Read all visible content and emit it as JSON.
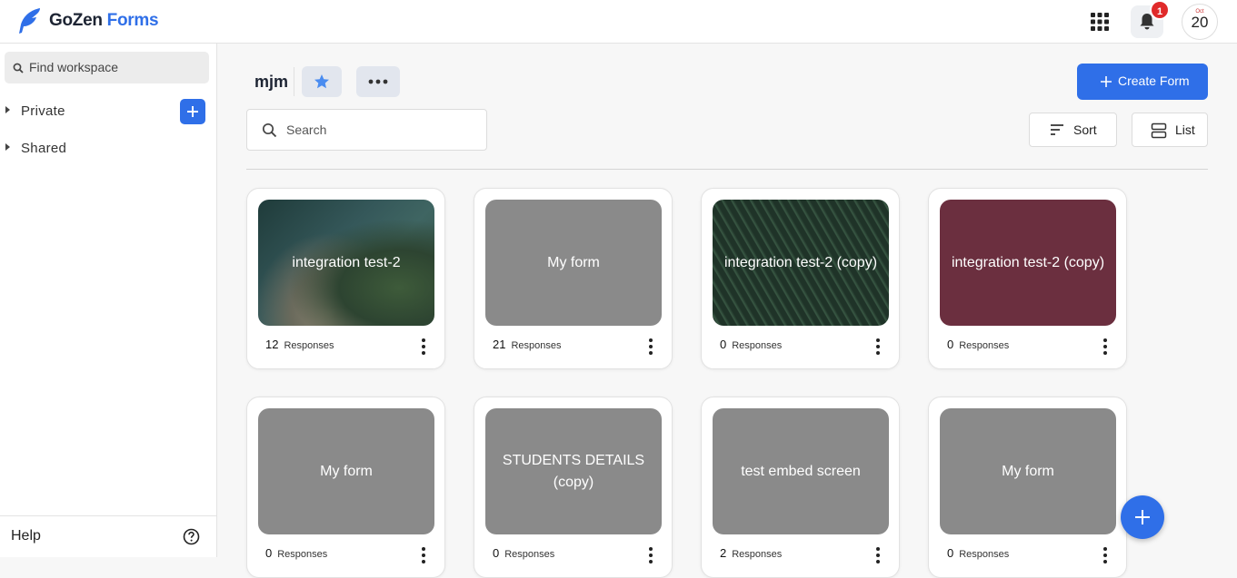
{
  "app": {
    "brand_primary": "GoZen",
    "brand_secondary": "Forms",
    "accent": "#2f6fe8"
  },
  "header": {
    "notification_count": "1",
    "avatar_small_text": "Oct",
    "avatar_text": "20"
  },
  "sidebar": {
    "search_placeholder": "Find workspace",
    "sections": [
      {
        "label": "Private"
      },
      {
        "label": "Shared"
      }
    ],
    "help_label": "Help"
  },
  "workspace": {
    "title": "mjm",
    "create_label": "Create Form",
    "search_placeholder": "Search",
    "sort_label": "Sort",
    "view_label": "List"
  },
  "forms": [
    {
      "title": "integration test-2",
      "responses": "12",
      "responses_label": "Responses",
      "theme": "sea"
    },
    {
      "title": "My form",
      "responses": "21",
      "responses_label": "Responses",
      "theme": "gray"
    },
    {
      "title": "integration test-2 (copy)",
      "responses": "0",
      "responses_label": "Responses",
      "theme": "leaf"
    },
    {
      "title": "integration test-2 (copy)",
      "responses": "0",
      "responses_label": "Responses",
      "theme": "wine"
    },
    {
      "title": "My form",
      "responses": "0",
      "responses_label": "Responses",
      "theme": "gray"
    },
    {
      "title": "STUDENTS DETAILS (copy)",
      "responses": "0",
      "responses_label": "Responses",
      "theme": "gray"
    },
    {
      "title": "test embed screen",
      "responses": "2",
      "responses_label": "Responses",
      "theme": "gray"
    },
    {
      "title": "My form",
      "responses": "0",
      "responses_label": "Responses",
      "theme": "gray"
    }
  ]
}
